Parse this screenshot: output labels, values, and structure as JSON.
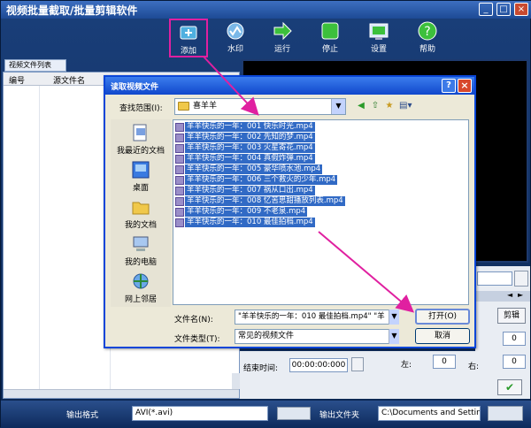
{
  "app": {
    "title": "视频批量截取/批量剪辑软件",
    "toolbar": [
      {
        "id": "add",
        "label": "添加",
        "icon": "add-video-icon"
      },
      {
        "id": "watermark",
        "label": "水印",
        "icon": "watermark-icon"
      },
      {
        "id": "run",
        "label": "运行",
        "icon": "run-arrow-icon"
      },
      {
        "id": "stop",
        "label": "停止",
        "icon": "stop-icon"
      },
      {
        "id": "settings",
        "label": "设置",
        "icon": "settings-icon"
      },
      {
        "id": "help",
        "label": "帮助",
        "icon": "help-icon"
      }
    ],
    "list_tab": "视频文件列表",
    "list_headers": [
      "编号",
      "源文件名"
    ],
    "clip_button": "剪辑",
    "end_time_label": "结束时间:",
    "end_time_value": "00:00:00:000",
    "left_label": "左:",
    "left_value": "0",
    "right_label": "右:",
    "right_value": "0",
    "field_a": "0",
    "field_b": "0",
    "bottom": {
      "output_format_label": "输出格式",
      "output_format_value": "AVI(*.avi)",
      "output_folder_label": "输出文件夹",
      "output_folder_value": "C:\\Documents and Setting"
    }
  },
  "dialog": {
    "title": "读取视频文件",
    "look_in_label": "查找范围(I):",
    "look_in_value": "喜羊羊",
    "places": [
      {
        "label": "我最近的文档",
        "icon": "recent-docs-icon"
      },
      {
        "label": "桌面",
        "icon": "desktop-icon"
      },
      {
        "label": "我的文档",
        "icon": "my-documents-icon"
      },
      {
        "label": "我的电脑",
        "icon": "my-computer-icon"
      },
      {
        "label": "网上邻居",
        "icon": "network-places-icon"
      }
    ],
    "files": [
      "羊羊快乐的一年：001 快乐时光.mp4",
      "羊羊快乐的一年：002 先知的梦.mp4",
      "羊羊快乐的一年：003 火星寄花.mp4",
      "羊羊快乐的一年：004 真假炸弹.mp4",
      "羊羊快乐的一年：005 豪华喷水池.mp4",
      "羊羊快乐的一年：006 三个救火的少年.mp4",
      "羊羊快乐的一年：007 祸从口出.mp4",
      "羊羊快乐的一年：008 忆苦思甜播放列表.mp4",
      "羊羊快乐的一年：009 不老泉.mp4",
      "羊羊快乐的一年：010 最佳拍档.mp4"
    ],
    "filename_label": "文件名(N):",
    "filename_value": "\"羊羊快乐的一年：010 最佳拍档.mp4\" \"羊",
    "filetype_label": "文件类型(T):",
    "filetype_value": "常见的视频文件",
    "open_button": "打开(O)",
    "cancel_button": "取消"
  },
  "colors": {
    "annotation": "#e020a0",
    "selection": "#316ac5",
    "titlebar": "#1047cc"
  }
}
